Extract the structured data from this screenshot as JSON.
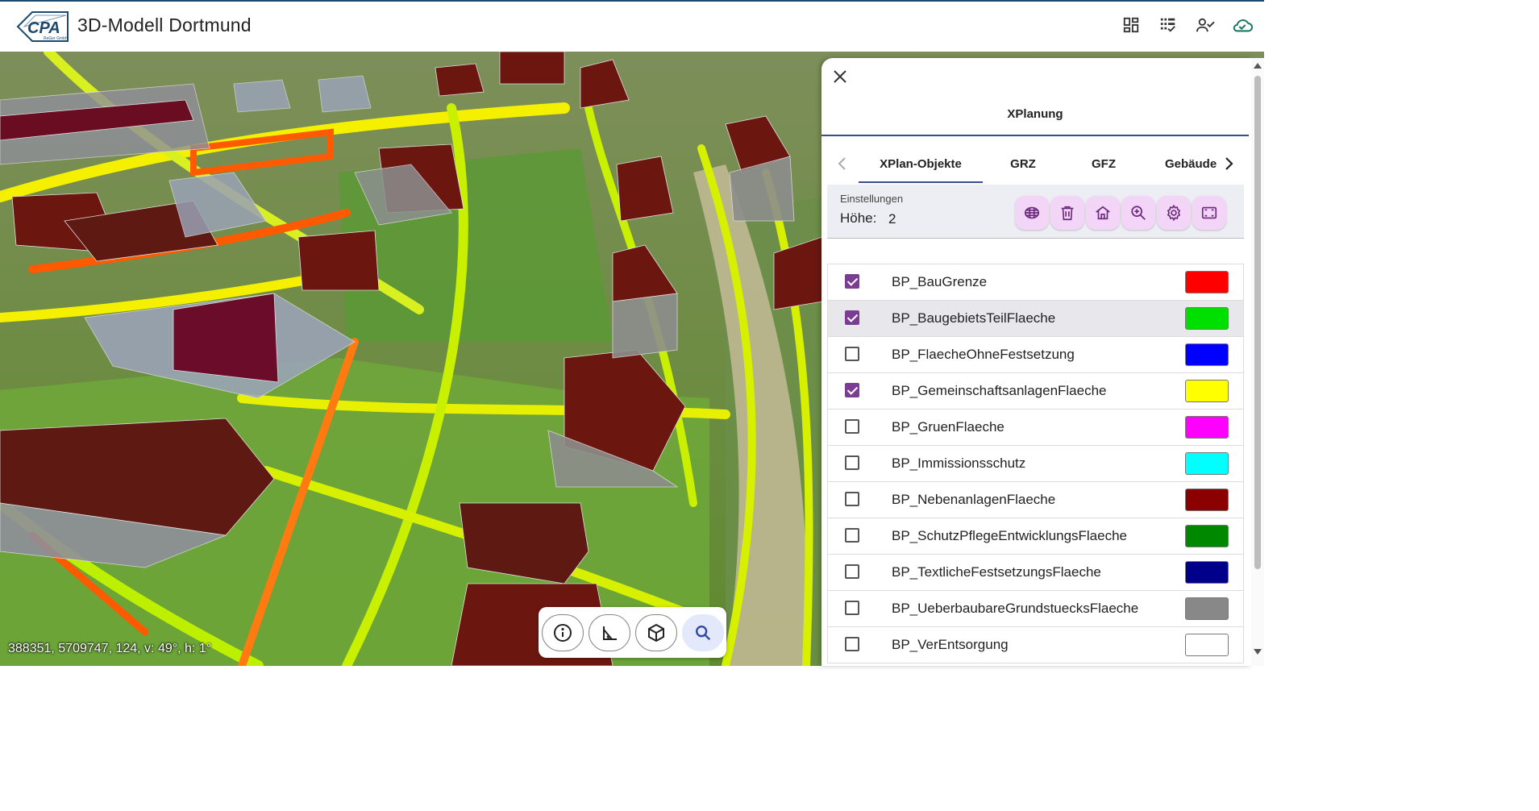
{
  "app": {
    "title": "3D-Modell Dortmund",
    "logo_text": "CPA",
    "logo_subtext": "ReGer GmbH"
  },
  "topbar_icons": [
    "dashboard-icon",
    "checklist-icon",
    "user-check-icon",
    "cloud-done-icon"
  ],
  "map": {
    "coords": "388351, 5709747, 124, v: 49°, h: 1°"
  },
  "toolbar": {
    "buttons": [
      "info-icon",
      "measure-angle-icon",
      "cube-icon",
      "search-icon"
    ],
    "active": "search-icon"
  },
  "panel": {
    "title": "XPlanung",
    "tabs": [
      "XPlan-Objekte",
      "GRZ",
      "GFZ",
      "Gebäude"
    ],
    "active_tab": "XPlan-Objekte",
    "settings": {
      "label": "Einstellungen",
      "height_label": "Höhe:",
      "height_value": "2",
      "buttons": [
        "grid-icon",
        "trash-icon",
        "home-icon",
        "zoom-in-icon",
        "gear-icon",
        "frame-icon"
      ]
    },
    "layers": [
      {
        "name": "BP_BauGrenze",
        "checked": true,
        "color": "#ff0000"
      },
      {
        "name": "BP_BaugebietsTeilFlaeche",
        "checked": true,
        "color": "#00e000"
      },
      {
        "name": "BP_FlaecheOhneFestsetzung",
        "checked": false,
        "color": "#0000ff"
      },
      {
        "name": "BP_GemeinschaftsanlagenFlaeche",
        "checked": true,
        "color": "#ffff00"
      },
      {
        "name": "BP_GruenFlaeche",
        "checked": false,
        "color": "#ff00ff"
      },
      {
        "name": "BP_Immissionsschutz",
        "checked": false,
        "color": "#00ffff"
      },
      {
        "name": "BP_NebenanlagenFlaeche",
        "checked": false,
        "color": "#8b0000"
      },
      {
        "name": "BP_SchutzPflegeEntwicklungsFlaeche",
        "checked": false,
        "color": "#008800"
      },
      {
        "name": "BP_TextlicheFestsetzungsFlaeche",
        "checked": false,
        "color": "#00008b"
      },
      {
        "name": "BP_UeberbaubareGrundstuecksFlaeche",
        "checked": false,
        "color": "#888888"
      },
      {
        "name": "BP_VerEntsorgung",
        "checked": false,
        "color": "#ffffff"
      }
    ],
    "highlighted_index": 1
  }
}
